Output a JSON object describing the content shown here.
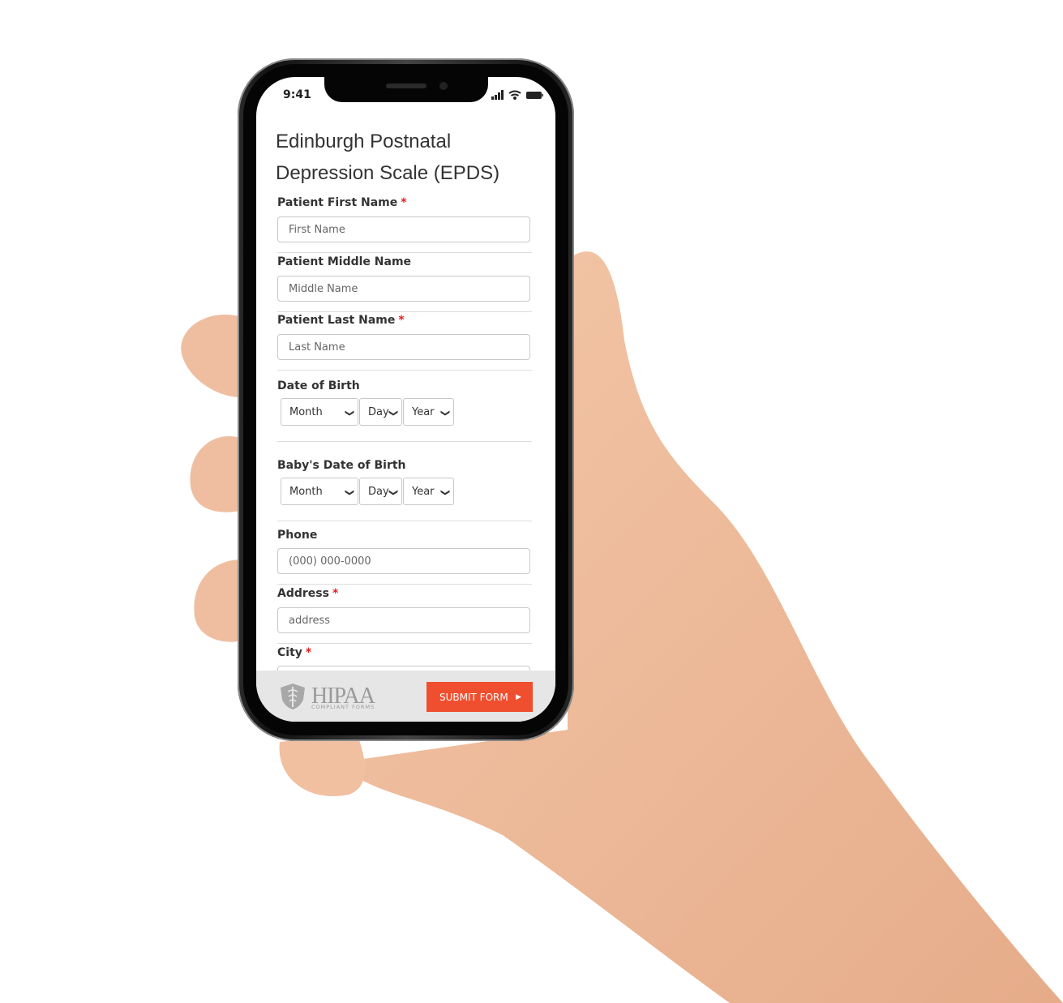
{
  "status_bar": {
    "time": "9:41"
  },
  "form": {
    "title": "Edinburgh Postnatal Depression Scale (EPDS)",
    "required_marker": "*",
    "first_name": {
      "label": "Patient First Name",
      "placeholder": "First Name",
      "required": true
    },
    "middle_name": {
      "label": "Patient Middle Name",
      "placeholder": "Middle Name",
      "required": false
    },
    "last_name": {
      "label": "Patient Last Name",
      "placeholder": "Last Name",
      "required": true
    },
    "dob": {
      "label": "Date of Birth",
      "month": "Month",
      "day": "Day",
      "year": "Year"
    },
    "baby_dob": {
      "label": "Baby's Date of Birth",
      "month": "Month",
      "day": "Day",
      "year": "Year"
    },
    "phone": {
      "label": "Phone",
      "placeholder": "(000) 000-0000"
    },
    "address": {
      "label": "Address",
      "placeholder": "address",
      "required": true
    },
    "city": {
      "label": "City",
      "required": true
    }
  },
  "footer": {
    "logo_text": "HIPAA",
    "logo_subtext": "COMPLIANT FORMS",
    "submit_label": "SUBMIT FORM",
    "submit_color": "#ef4f2f"
  }
}
